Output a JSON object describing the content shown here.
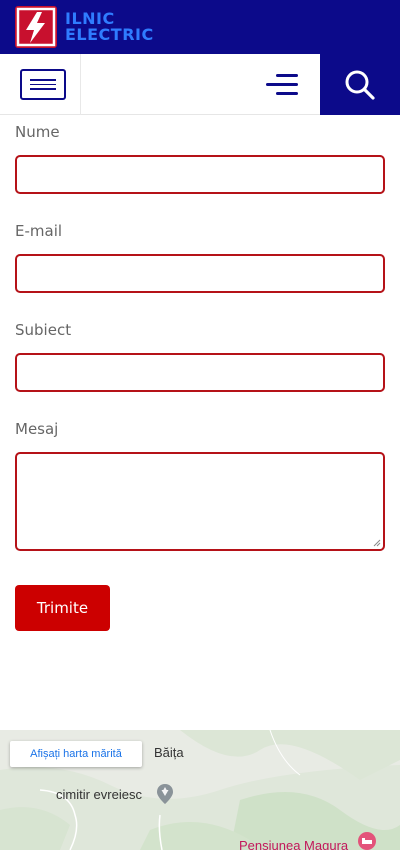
{
  "header": {
    "brand_line1": "ILNIC",
    "brand_line2": "ELECTRIC"
  },
  "nav": {
    "menu_icon": "menu-icon",
    "hamburger_icon": "hamburger-icon",
    "search_icon": "search-icon"
  },
  "form": {
    "name_label": "Nume",
    "email_label": "E-mail",
    "subject_label": "Subiect",
    "message_label": "Mesaj",
    "name_value": "",
    "email_value": "",
    "subject_value": "",
    "message_value": "",
    "submit_label": "Trimite"
  },
  "map": {
    "view_larger_label": "Afișați harta mărită",
    "place_1": "Băița",
    "place_2": "cimitir evreiesc",
    "place_3": "Pensiunea Magura"
  },
  "colors": {
    "brand_blue": "#0c0a8a",
    "accent_red": "#cc0000",
    "input_border": "#b51218"
  }
}
